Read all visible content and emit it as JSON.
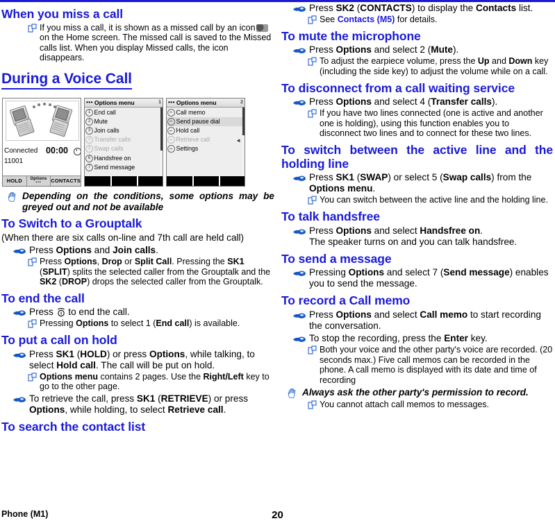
{
  "document": {
    "footer_left": "Phone (M1)",
    "page_number": "20",
    "heading_color": "#1a1ad6"
  },
  "left_column": {
    "section_miss_call": {
      "heading": "When you miss a call",
      "note": "If you miss a call, it is shown as a missed call by an icon        on the Home screen. The missed call is saved to the Missed calls list. When you display Missed calls, the icon disappears."
    },
    "section_during_voice_call": {
      "heading": "During a Voice Call",
      "warning": "Depending on the conditions, some options may be greyed out and not be available"
    },
    "section_grouptalk": {
      "heading": "To Switch to a Grouptalk",
      "intro": "(When there are six calls on-line and 7th call are held call)",
      "item": "Press Options and Join calls.",
      "item_parts": {
        "press": "Press ",
        "options": "Options",
        "and": " and ",
        "join_calls": "Join calls",
        "period": "."
      },
      "note_parts": {
        "press": "Press ",
        "options": "Options",
        "comma": ", ",
        "drop": "Drop",
        "or": " or ",
        "split_call": "Split Call",
        "pressing": ". Pressing the ",
        "sk1": "SK1",
        "split_paren": " (",
        "split": "SPLIT",
        "splits_text": ") splits the selected caller from the Grouptalk and the ",
        "sk2": "SK2",
        "drop_paren": " (",
        "drop2": "DROP",
        "drops_text": ") drops the selected caller from the Grouptalk."
      }
    },
    "section_end_call": {
      "heading": "To end the call",
      "item_before_key": "Press ",
      "item_after_key": " to end the call.",
      "note_parts": {
        "pressing": "Pressing ",
        "options": "Options",
        "to_select": " to select 1 (",
        "end_call": "End call",
        "available": ") is available."
      }
    },
    "section_hold": {
      "heading": "To put a call on hold",
      "item1_parts": {
        "press": "Press ",
        "sk1": "SK1",
        "hold_open": " (",
        "hold": "HOLD",
        "or_press": ") or press ",
        "options": "Options",
        "while": ", while talking, to select ",
        "hold_call": "Hold call",
        "tail": ". The call will be put on hold."
      },
      "note_parts": {
        "options_menu": "Options menu",
        "contains": " contains 2 pages. Use the ",
        "right_left": "Right/Left",
        "tail": " key to go to the other page."
      },
      "item2_parts": {
        "lead": "To retrieve the call, press ",
        "sk1": "SK1",
        "open": " (",
        "retrieve": "RETRIEVE",
        "or_press": ") or press ",
        "options": "Options",
        "while": ", while holding, to select ",
        "retrieve_call": "Retrieve call",
        "period": "."
      }
    },
    "section_search_contacts": {
      "heading": "To search the contact list"
    }
  },
  "right_column": {
    "contacts_item": {
      "press": "Press ",
      "sk2": "SK2",
      "open": " (",
      "contacts_caps": "CONTACTS",
      "mid": ") to display the ",
      "contacts": "Contacts",
      "tail": " list."
    },
    "contacts_note": {
      "see": "See ",
      "link": "Contacts (M5)",
      "tail": " for details."
    },
    "section_mute": {
      "heading": "To mute the microphone",
      "item_parts": {
        "press": "Press ",
        "options": "Options",
        "select": " and select 2 (",
        "mute": "Mute",
        "tail": ")."
      },
      "note_parts": {
        "lead": "To adjust the earpiece volume, press the ",
        "up": "Up",
        "and": " and ",
        "down": "Down",
        "tail": " key (including the side key) to adjust the volume while on a call."
      }
    },
    "section_disconnect": {
      "heading": "To disconnect from a call waiting service",
      "item_parts": {
        "press": "Press ",
        "options": "Options",
        "select": " and select 4 (",
        "transfer": "Transfer calls",
        "tail": ")."
      },
      "note": "If you have two lines connected (one is active and another one is holding), using this function enables you to disconnect two lines and to connect for these two lines."
    },
    "section_switch_line": {
      "heading": "To switch between the active line and the holding line",
      "heading_line1": "To switch between the active line and the",
      "heading_line2": "holding line",
      "item_parts": {
        "press": "Press ",
        "sk1": "SK1",
        "open": " (",
        "swap": "SWAP",
        "mid": ") or select 5 (",
        "swap_calls": "Swap calls",
        "from": ") from the ",
        "options_menu": "Options menu",
        "period": "."
      },
      "note": "You can switch between the active line and the holding line."
    },
    "section_handsfree": {
      "heading": "To talk handsfree",
      "item_parts": {
        "press": "Press ",
        "options": "Options",
        "select": " and select ",
        "handsfree": "Handsfree on",
        "tail": "."
      },
      "item_line2": "The speaker turns on and you can talk handsfree."
    },
    "section_send_message": {
      "heading": "To send a message",
      "item_parts": {
        "pressing": "Pressing ",
        "options": "Options",
        "select": " and select 7 (",
        "send_message": "Send message",
        "tail": ") enables you to send the message."
      }
    },
    "section_call_memo": {
      "heading": "To record a Call memo",
      "item1_parts": {
        "press": "Press ",
        "options": "Options",
        "select": " and select ",
        "call_memo": "Call memo",
        "tail": " to start recording the conversation."
      },
      "item2_parts": {
        "lead": "To stop the recording, press the ",
        "enter": "Enter",
        "tail": " key."
      },
      "note": "Both your voice and the other party's voice are recorded. (20 seconds max.) Five call memos can be recorded in the phone. A call memo is displayed with its date and time of recording",
      "warning": "Always ask the other party's permission to record.",
      "note2": "You cannot attach call memos to messages."
    }
  },
  "figure": {
    "call_screen": {
      "status": "Connected",
      "timer": "00:00",
      "number": "11001",
      "softkeys": {
        "left": "HOLD",
        "center": "Options",
        "center_dots": "•••",
        "right": "CONTACTS"
      }
    },
    "options_menu_page1": {
      "title": "Options menu",
      "page_indicator": "1",
      "items": [
        {
          "num": "1",
          "label": "End call",
          "greyed": false
        },
        {
          "num": "2",
          "label": "Mute",
          "greyed": false
        },
        {
          "num": "3",
          "label": "Join calls",
          "greyed": false
        },
        {
          "num": "4",
          "label": "Transfer calls",
          "greyed": true
        },
        {
          "num": "5",
          "label": "Swap calls",
          "greyed": true
        },
        {
          "num": "6",
          "label": "Handsfree on",
          "greyed": false
        },
        {
          "num": "7",
          "label": "Send message",
          "greyed": false
        }
      ]
    },
    "options_menu_page2": {
      "title": "Options menu",
      "page_indicator": "2",
      "items": [
        {
          "label": "Call memo",
          "greyed": false,
          "highlighted": false
        },
        {
          "label": "Send pause dial",
          "greyed": false,
          "highlighted": true
        },
        {
          "label": "Hold call",
          "greyed": false,
          "highlighted": false
        },
        {
          "label": "Retrieve call",
          "greyed": true,
          "highlighted": false
        },
        {
          "label": "Settings",
          "greyed": false,
          "highlighted": false
        }
      ]
    }
  }
}
